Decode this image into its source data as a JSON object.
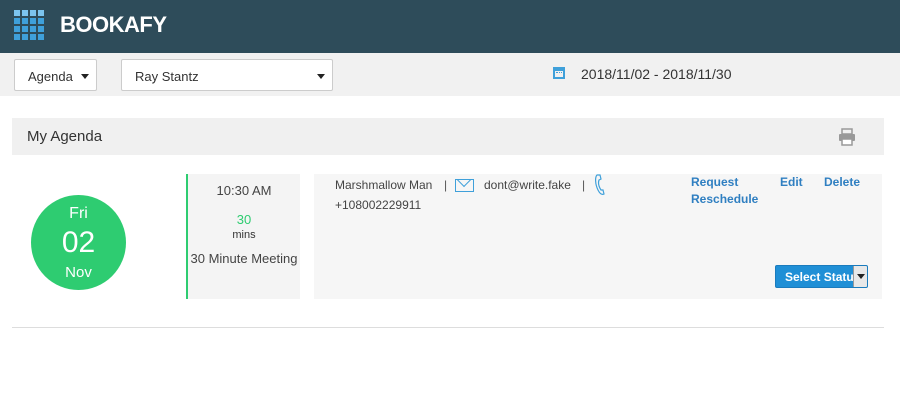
{
  "app": {
    "brand": "BOOKAFY"
  },
  "toolbar": {
    "view_select": "Agenda",
    "staff_select": "Ray Stantz",
    "date_range": "2018/11/02 - 2018/11/30"
  },
  "agenda": {
    "title": "My Agenda",
    "appointment": {
      "weekday": "Fri",
      "day": "02",
      "month": "Nov",
      "time": "10:30 AM",
      "duration": "30",
      "duration_unit": "mins",
      "service": "30 Minute Meeting",
      "customer_name": "Marshmallow Man",
      "separator": "|",
      "email": "dont@write.fake",
      "phone": "+108002229911",
      "actions": {
        "reschedule": "Request Reschedule",
        "edit": "Edit",
        "delete": "Delete"
      },
      "status_button": "Select Status"
    }
  },
  "colors": {
    "topbar": "#2e4c5a",
    "accent": "#3fa0da",
    "green": "#2ecc71",
    "link": "#2f7fc1",
    "status_button": "#1f8fd6"
  },
  "icons": [
    "calendar-icon",
    "printer-icon",
    "mail-icon",
    "phone-icon",
    "logo-grid-icon"
  ]
}
